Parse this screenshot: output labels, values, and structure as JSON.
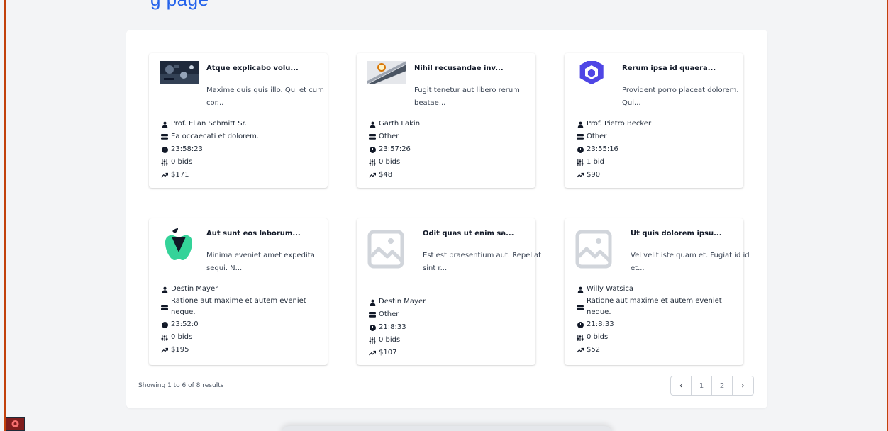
{
  "header": {
    "title": "g page"
  },
  "cards": [
    {
      "title": "Atque explicabo volu...",
      "description": "Maxime quis quis illo. Qui et cum cor...",
      "seller": "Prof. Elian Schmitt Sr.",
      "category": "Ea occaecati et dolorem.",
      "time_left": "23:58:23",
      "bids": "0 bids",
      "price": "$171",
      "thumbnail": "circuit-board-photo"
    },
    {
      "title": "Nihil recusandae inv...",
      "description": "Fugit tenetur aut libero rerum beatae...",
      "seller": "Garth Lakin",
      "category": "Other",
      "time_left": "23:57:26",
      "bids": "0 bids",
      "price": "$48",
      "thumbnail": "wristwatch-photo"
    },
    {
      "title": "Rerum ipsa id quaera...",
      "description": "Provident porro placeat dolorem. Qui...",
      "seller": "Prof. Pietro Becker",
      "category": "Other",
      "time_left": "23:55:16",
      "bids": "1 bid",
      "price": "$90",
      "thumbnail": "hexagon-logo"
    },
    {
      "title": "Aut sunt eos laborum...",
      "description": "Minima eveniet amet expedita sequi. N...",
      "seller": "Destin Mayer",
      "category": "Ratione aut maxime et autem eveniet neque.",
      "time_left": "23:52:0",
      "bids": "0 bids",
      "price": "$195",
      "thumbnail": "apple-logo"
    },
    {
      "title": "Odit quas ut enim sa...",
      "description": "Est est praesentium aut. Repellat sint r...",
      "seller": "Destin Mayer",
      "category": "Other",
      "time_left": "21:8:33",
      "bids": "0 bids",
      "price": "$107",
      "thumbnail": "image-placeholder-icon"
    },
    {
      "title": "Ut quis dolorem ipsu...",
      "description": "Vel velit iste quam et. Fugiat id id et...",
      "seller": "Willy Watsica",
      "category": "Ratione aut maxime et autem eveniet neque.",
      "time_left": "21:8:33",
      "bids": "0 bids",
      "price": "$52",
      "thumbnail": "image-placeholder-icon"
    }
  ],
  "footer": {
    "showing_text": "Showing 1 to 6 of 8 results",
    "pagination": {
      "prev": "‹",
      "pages": [
        "1",
        "2"
      ],
      "next": "›"
    }
  },
  "icons": {
    "seller": "user-icon",
    "category": "database-icon",
    "time_left": "clock-icon",
    "bids": "sliders-icon",
    "price": "trending-up-icon"
  },
  "colors": {
    "accent": "#2563eb",
    "border_accent": "#c2410c",
    "hexagon_logo": "#4f46e5",
    "apple_logo": "#34d399",
    "placeholder": "#d1d5db"
  }
}
